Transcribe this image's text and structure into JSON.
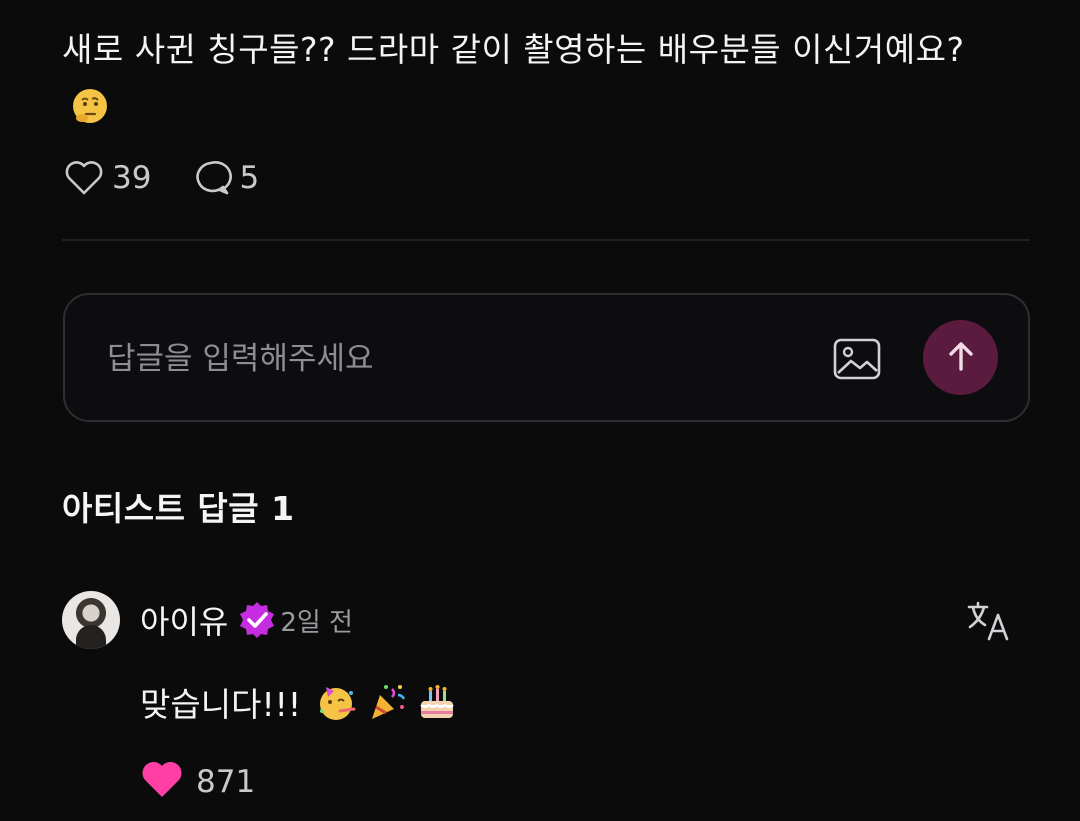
{
  "post": {
    "text": "새로 사귄 칭구들?? 드라마 같이 촬영하는 배우분들 이신거예요?",
    "emoji": "thinking-face-emoji",
    "likes": "39",
    "comments": "5"
  },
  "reply": {
    "placeholder": "답글을 입력해주세요",
    "value": "",
    "send_color": "#5a1b3e"
  },
  "artist_section": {
    "title": "아티스트 답글 1"
  },
  "comment": {
    "author": "아이유",
    "verified_color": "#c72de0",
    "time": "2일 전",
    "text": "맞습니다!!!",
    "emojis": [
      "partying-face-emoji",
      "party-popper-emoji",
      "birthday-cake-emoji"
    ],
    "likes": "871",
    "like_color": "#ff3fa4"
  },
  "icons": {
    "like": "heart-outline-icon",
    "comment": "speech-bubble-icon",
    "image": "image-icon",
    "send": "arrow-up-icon",
    "translate": "translate-icon"
  }
}
